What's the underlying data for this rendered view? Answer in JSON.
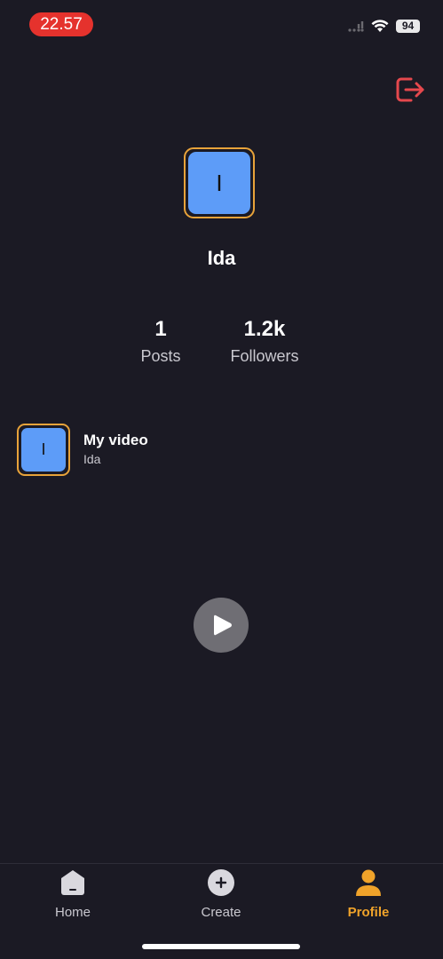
{
  "status_bar": {
    "time": "22.57",
    "battery": "94",
    "time_badge_color": "#e5322d"
  },
  "header": {
    "logout_icon": "logout-icon",
    "logout_color": "#e5484d"
  },
  "profile": {
    "avatar_initial": "I",
    "name": "Ida",
    "stats": [
      {
        "value": "1",
        "label": "Posts"
      },
      {
        "value": "1.2k",
        "label": "Followers"
      }
    ]
  },
  "videos": [
    {
      "initial": "I",
      "title": "My video",
      "author": "Ida"
    }
  ],
  "player": {
    "icon": "play-icon"
  },
  "bottom_nav": {
    "items": [
      {
        "label": "Home",
        "icon": "home-icon",
        "active": false
      },
      {
        "label": "Create",
        "icon": "plus-icon",
        "active": false
      },
      {
        "label": "Profile",
        "icon": "person-icon",
        "active": true
      }
    ],
    "active_color": "#f0a32a"
  },
  "colors": {
    "background": "#1b1a24",
    "accent": "#e8a33a",
    "avatar_fill": "#5d9cf8"
  }
}
